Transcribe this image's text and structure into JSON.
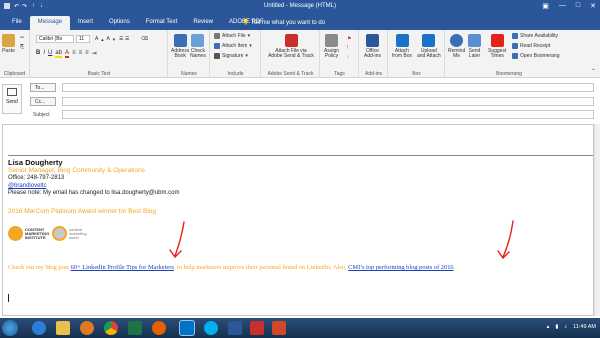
{
  "window": {
    "title": "Untitled - Message (HTML)",
    "controls": [
      "—",
      "□",
      "✕"
    ]
  },
  "tabs": [
    "File",
    "Message",
    "Insert",
    "Options",
    "Format Text",
    "Review",
    "ADOBE PDF"
  ],
  "tell_me": "Tell me what you want to do",
  "ribbon": {
    "clipboard": {
      "label": "Clipboard",
      "paste": "Paste",
      "cut": "✂",
      "copy": "⎘"
    },
    "basic_text": {
      "label": "Basic Text",
      "font": "Calibri (Bo",
      "size": "11",
      "bold": "B",
      "italic": "I",
      "underline": "U"
    },
    "names": {
      "label": "Names",
      "address_book": "Address\nBook",
      "check_names": "Check\nNames"
    },
    "include": {
      "label": "Include",
      "attach_file": "Attach File",
      "attach_item": "Attach Item",
      "signature": "Signature"
    },
    "adobe": {
      "label": "Adobe Send & Track",
      "attach_track": "Attach File via\nAdobe Send & Track"
    },
    "tags": {
      "label": "Tags",
      "assign_policy": "Assign\nPolicy"
    },
    "addins": {
      "label": "Add-ins",
      "office_addins": "Office\nAdd-ins"
    },
    "box": {
      "label": "Box",
      "attach_from_box": "Attach\nfrom Box",
      "upload_attach": "Upload\nand Attach"
    },
    "boomerang": {
      "label": "Boomerang",
      "remind_me": "Remind\nMe",
      "send_later": "Send\nLater",
      "suggest_times": "Suggest\nTimes",
      "share_availability": "Share Availability",
      "read_receipt": "Read Receipt",
      "open_boomerang": "Open Boomerang"
    }
  },
  "header": {
    "send": "Send",
    "to_label": "To...",
    "cc_label": "Cc...",
    "subject_label": "Subject"
  },
  "signature": {
    "name": "Lisa Dougherty",
    "title": "Senior Manager, Blog Community & Operations",
    "office": "Office: 248-797-2813",
    "handle": "@brandloveltc",
    "note": "Please note: My email has changed to lisa.dougherty@ubm.com",
    "award": "2016 MarCom Platinum Award winner for Best Blog",
    "logo1": "CONTENT\nMARKETING\nINSTITUTE",
    "logo2": "content\nmarketing\nworld"
  },
  "promo": {
    "before": "Check out my blog post ",
    "link1": "60+ LinkedIn Profile Tips for Marketers",
    "middle": ", to help marketers improve their personal brand on LinkedIn. Also, ",
    "link2": "CMI’s top performing blog posts of 2016",
    "end": "."
  },
  "taskbar": {
    "clock": "11:49 AM"
  },
  "colors": {
    "titlebar": "#2b579a",
    "signature_orange": "#f5a623",
    "link_blue": "#1f3fbf",
    "annotation_red": "#e3231b"
  }
}
